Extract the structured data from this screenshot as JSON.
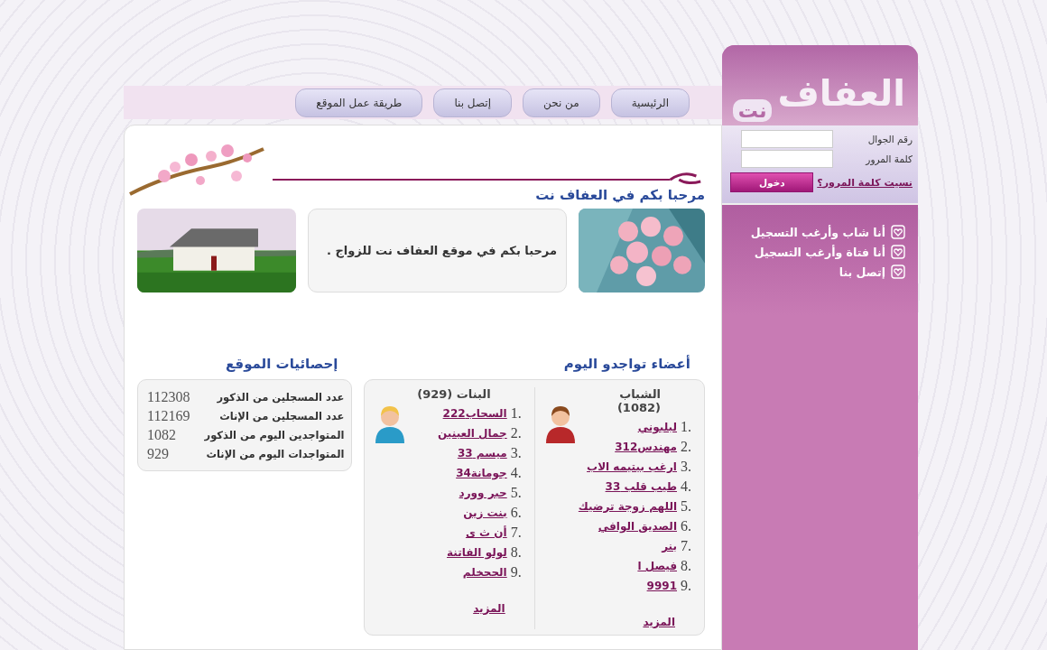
{
  "logo": {
    "main": "العفاف",
    "suffix": "نت"
  },
  "nav": [
    {
      "label": "الرئيسية"
    },
    {
      "label": "من نحن"
    },
    {
      "label": "إتصل بنا"
    },
    {
      "label": "طريقة عمل الموقع"
    }
  ],
  "login": {
    "fields": [
      {
        "label": "رقم الجوال"
      },
      {
        "label": "كلمة المرور"
      }
    ],
    "forgot": "نسيت كلمة المرور؟",
    "submit": "دخول"
  },
  "side_links": [
    "أنا شاب وأرغب التسجيل",
    "أنا فتاة وأرغب التسجيل",
    "إتصل بنا"
  ],
  "welcome": {
    "title": "مرحبا بكم في العفاف نت",
    "message": "مرحبا بكم في موقع العفاف نت للزواج ."
  },
  "members": {
    "title": "أعضاء تواجدو اليوم",
    "groups": [
      {
        "kind": "male",
        "heading": "الشباب (1082)",
        "more": "المزيد",
        "items": [
          {
            "number": "1.",
            "name": "لبلبوني"
          },
          {
            "number": "2.",
            "name": "مهندس312"
          },
          {
            "number": "3.",
            "name": "ارغب بيتيمه الاب"
          },
          {
            "number": "4.",
            "name": "طيب قلب 33"
          },
          {
            "number": "5.",
            "name": "اللهم زوجة ترضيك"
          },
          {
            "number": "6.",
            "name": "الصديق الوافي"
          },
          {
            "number": "7.",
            "name": "بنر"
          },
          {
            "number": "8.",
            "name": "فيصل ا"
          },
          {
            "number": "9.",
            "name": "9991"
          }
        ]
      },
      {
        "kind": "female",
        "heading": "البنات (929)",
        "more": "المزيد",
        "items": [
          {
            "number": "1.",
            "name": "السحاب222"
          },
          {
            "number": "2.",
            "name": "جمال العينين"
          },
          {
            "number": "3.",
            "name": "ميسم 33"
          },
          {
            "number": "4.",
            "name": "جومانة34"
          },
          {
            "number": "5.",
            "name": "حبر وورد"
          },
          {
            "number": "6.",
            "name": "بنت زين"
          },
          {
            "number": "7.",
            "name": "أن ث ى"
          },
          {
            "number": "8.",
            "name": "لولو الفاتنة"
          },
          {
            "number": "9.",
            "name": "الححخلم"
          }
        ]
      }
    ]
  },
  "stats": {
    "title": "إحصائيات الموقع",
    "rows": [
      {
        "label": "عدد المسجلين من الذكور",
        "value": "112308"
      },
      {
        "label": "عدد المسجلين من الإناث",
        "value": "112169"
      },
      {
        "label": "المتواجدين اليوم من الذكور",
        "value": "1082"
      },
      {
        "label": "المتواجدات اليوم من الإناث",
        "value": "929"
      }
    ]
  }
}
